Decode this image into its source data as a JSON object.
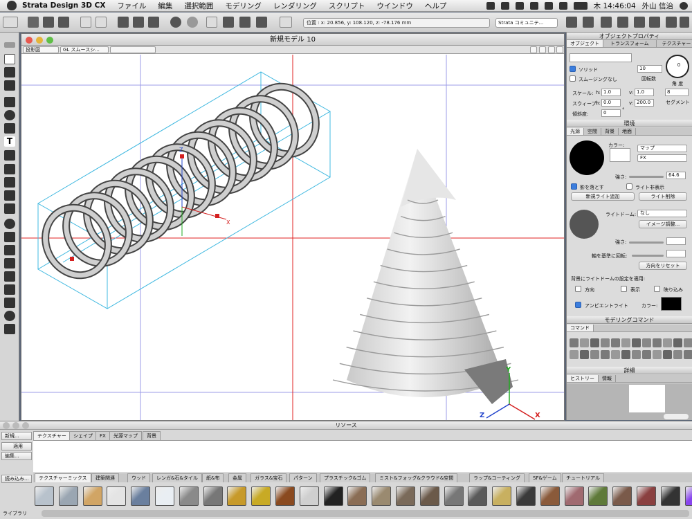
{
  "menubar": {
    "app_name": "Strata Design 3D CX",
    "items": [
      "ファイル",
      "編集",
      "選択範囲",
      "モデリング",
      "レンダリング",
      "スクリプト",
      "ウインドウ",
      "ヘルプ"
    ],
    "clock": "木 14:46:04",
    "user": "外山 信治"
  },
  "toolbar": {
    "coords": "位置 : x: 20.856, y: 108.120, z: -78.176 mm",
    "community": "Strata コミュニテ..."
  },
  "document": {
    "title": "新規モデル 10",
    "view_select": "投影図",
    "render_select": "GL スムースシ..."
  },
  "axes": {
    "x": "X",
    "y": "Y",
    "z": "Z"
  },
  "object_panel": {
    "title": "オブジェクトプロパティ",
    "tabs": [
      "オブジェクト",
      "トランスフォーム",
      "テクスチャー"
    ],
    "solid_label": "ソリッド",
    "smoothing_label": "スムージングなし",
    "turns_value": "10",
    "turns_label": "回転数",
    "angle_value": "0",
    "angle_label": "角 度",
    "scale_label": "スケール:",
    "scale_h_label": "h:",
    "scale_h": "1.0",
    "scale_v_label": "v:",
    "scale_v": "1.0",
    "segments_value": "8",
    "segments_label": "セグメント",
    "sweep_label": "スウィープ:",
    "sweep_h_label": "h:",
    "sweep_h": "0.0",
    "sweep_v_label": "v:",
    "sweep_v": "200.0",
    "tilt_label": "傾斜度:",
    "tilt_value": "0",
    "tilt_unit": "°"
  },
  "env_panel": {
    "title": "環境",
    "tabs": [
      "光源",
      "空間",
      "背景",
      "地面"
    ],
    "color_label": "カラー:",
    "map_select": "マップ",
    "fx_select": "FX",
    "strength_label": "強さ:",
    "strength_value": "64.6",
    "shadow_label": "影を落とす",
    "hide_light_label": "ライト非表示",
    "new_light_button": "新規ライト追加",
    "delete_light_button": "ライト削除",
    "dome_label": "ライトドーム:",
    "dome_select": "なし",
    "image_adjust_button": "イメージ調整...",
    "dome_strength_label": "強さ:",
    "rotate_label": "軸を基準に回転:",
    "reset_dir_button": "方向をリセット",
    "apply_label": "背景にライトドームの設定を適用:",
    "direction_label": "方向",
    "show_label": "表示",
    "reflect_label": "映り込み",
    "ambient_label": "アンビエントライト",
    "ambient_color_label": "カラー:"
  },
  "modeling_panel": {
    "title": "モデリングコマンド",
    "tab": "コマンド"
  },
  "detail_panel": {
    "title": "詳細",
    "tabs": [
      "ヒストリー",
      "情報"
    ]
  },
  "resources": {
    "title": "リソース",
    "tabs": [
      "テクスチャー",
      "シェイプ",
      "FX",
      "光源マップ",
      "背景"
    ],
    "new_button": "新規...",
    "apply_button": "適用",
    "edit_button": "編集...",
    "load_button": "読み込み...",
    "library_label": "ライブラリ",
    "categories": [
      "テクスチャーミックス",
      "建築関連",
      "ウッド",
      "レンガ&石&タイル",
      "紙&布",
      "金属",
      "ガラス&宝石",
      "パターン",
      "プラスチック&ゴム",
      "ミスト&フォッグ&クラウド&空間",
      "ラップ&コーティング",
      "SF&ゲーム",
      "チュートリアル"
    ]
  },
  "colors": {
    "selection_box": "#3fb8e0",
    "grid_red": "#e02020",
    "grid_blue": "#5a5ad8",
    "axis_x": "#d42020",
    "axis_y": "#22aa22",
    "axis_z": "#2244cc"
  },
  "icons": [
    "apple-icon",
    "wifi-icon",
    "battery-icon",
    "spotlight-icon",
    "undo-icon",
    "redo-icon",
    "pointer-tool-icon",
    "text-tool-icon",
    "hand-tool-icon",
    "zoom-tool-icon"
  ]
}
